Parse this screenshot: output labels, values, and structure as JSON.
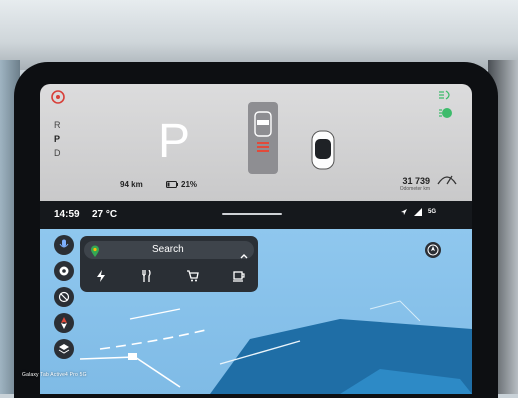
{
  "vehicle": {
    "gear_selector": [
      "R",
      "P",
      "D"
    ],
    "active_gear": "P",
    "range": "94 km",
    "battery": "21%",
    "odometer_value": "31 739",
    "odometer_label": "Odometer km"
  },
  "statusbar": {
    "time": "14:59",
    "temperature": "27 °C",
    "network": "5G"
  },
  "map": {
    "search_label": "Search",
    "categories": [
      "charging-icon",
      "restaurant-icon",
      "shopping-icon",
      "coffee-icon"
    ]
  },
  "watermark": "Galaxy Tab Active4 Pro 5G",
  "colors": {
    "alert_red": "#d8403a",
    "lights_green": "#3dbb6b",
    "map_water": "#86c1ea",
    "map_land": "#1f6ea6",
    "fab_dark": "#2b2f35"
  }
}
